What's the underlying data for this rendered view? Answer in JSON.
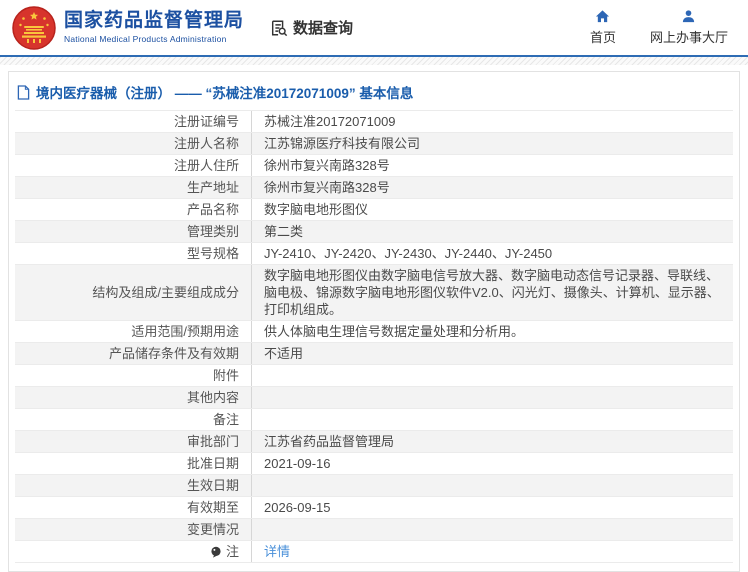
{
  "colors": {
    "brand_blue": "#1c50a1",
    "icon_blue": "#2d66b5",
    "header_rule_blue": "#2e6cb4",
    "title_blue": "#1a5dac",
    "link_blue": "#4a90d9",
    "emblem_red": "#d7342c",
    "emblem_yellow": "#f9c63c",
    "row_shade_grey": "#f3f3f3"
  },
  "header": {
    "org_name_zh": "国家药品监督管理局",
    "org_name_en": "National Medical Products Administration",
    "logo_icon": "national-emblem-icon",
    "data_query": {
      "label": "数据查询",
      "icon": "document-search-icon"
    },
    "nav": [
      {
        "label": "首页",
        "icon": "home-icon"
      },
      {
        "label": "网上办事大厅",
        "icon": "user-icon"
      }
    ]
  },
  "page": {
    "title_icon": "document-icon",
    "title": "境内医疗器械（注册） —— “苏械注准20172071009” 基本信息"
  },
  "table": {
    "rows": [
      {
        "label": "注册证编号",
        "value": "苏械注准20172071009"
      },
      {
        "label": "注册人名称",
        "value": "江苏锦源医疗科技有限公司"
      },
      {
        "label": "注册人住所",
        "value": "徐州市复兴南路328号"
      },
      {
        "label": "生产地址",
        "value": "徐州市复兴南路328号"
      },
      {
        "label": "产品名称",
        "value": "数字脑电地形图仪"
      },
      {
        "label": "管理类别",
        "value": "第二类"
      },
      {
        "label": "型号规格",
        "value": "JY-2410、JY-2420、JY-2430、JY-2440、JY-2450"
      },
      {
        "label": "结构及组成/主要组成成分",
        "value": "数字脑电地形图仪由数字脑电信号放大器、数字脑电动态信号记录器、导联线、脑电极、锦源数字脑电地形图仪软件V2.0、闪光灯、摄像头、计算机、显示器、打印机组成。"
      },
      {
        "label": "适用范围/预期用途",
        "value": "供人体脑电生理信号数据定量处理和分析用。"
      },
      {
        "label": "产品储存条件及有效期",
        "value": "不适用"
      },
      {
        "label": "附件",
        "value": ""
      },
      {
        "label": "其他内容",
        "value": ""
      },
      {
        "label": "备注",
        "value": ""
      },
      {
        "label": "审批部门",
        "value": "江苏省药品监督管理局"
      },
      {
        "label": "批准日期",
        "value": "2021-09-16"
      },
      {
        "label": "生效日期",
        "value": ""
      },
      {
        "label": "有效期至",
        "value": "2026-09-15"
      },
      {
        "label": "变更情况",
        "value": ""
      },
      {
        "label": "注",
        "value": "详情",
        "link": true,
        "label_icon": "note-icon"
      }
    ]
  }
}
